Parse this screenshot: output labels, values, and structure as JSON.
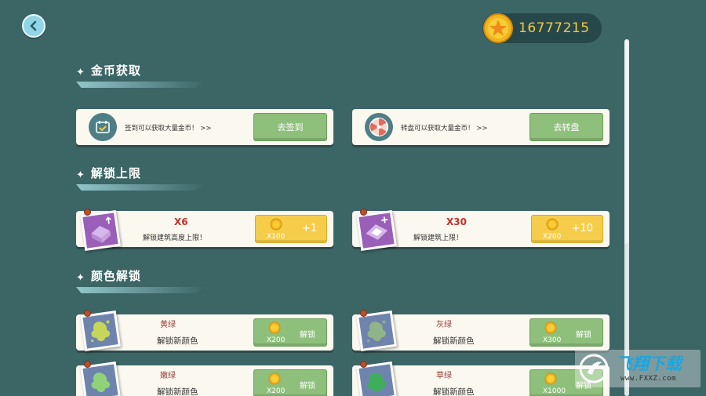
{
  "coins": {
    "amount": "16777215"
  },
  "sections": {
    "gold": {
      "title": "金币获取"
    },
    "limit": {
      "title": "解锁上限"
    },
    "color": {
      "title": "颜色解锁"
    }
  },
  "gold_cards": [
    {
      "text": "签到可以获取大量金币！ >>",
      "button": "去签到"
    },
    {
      "text": "转盘可以获取大量金币！ >>",
      "button": "去转盘"
    }
  ],
  "limit_cards": [
    {
      "multiplier": "X6",
      "desc": "解锁建筑高度上限！",
      "cost": "X100",
      "gain": "+1"
    },
    {
      "multiplier": "X30",
      "desc": "解锁建筑上限！",
      "cost": "X200",
      "gain": "+10"
    }
  ],
  "color_cards": [
    {
      "name": "黄绿",
      "desc": "解锁新颜色",
      "cost": "X200",
      "action": "解锁"
    },
    {
      "name": "灰绿",
      "desc": "解锁新颜色",
      "cost": "X300",
      "action": "解锁"
    },
    {
      "name": "嫩绿",
      "desc": "解锁新颜色",
      "cost": "X200",
      "action": "解锁"
    },
    {
      "name": "草绿",
      "desc": "解锁新颜色",
      "cost": "X1000",
      "action": "解锁"
    }
  ],
  "watermark": {
    "title": "飞翔下载",
    "url": "www.FXXZ.com"
  },
  "colors": {
    "background": "#3c6566",
    "button_green": "#8ec07c",
    "button_yellow": "#f6cd4a",
    "card": "#fbf8ef",
    "coin": "#f5c842"
  }
}
